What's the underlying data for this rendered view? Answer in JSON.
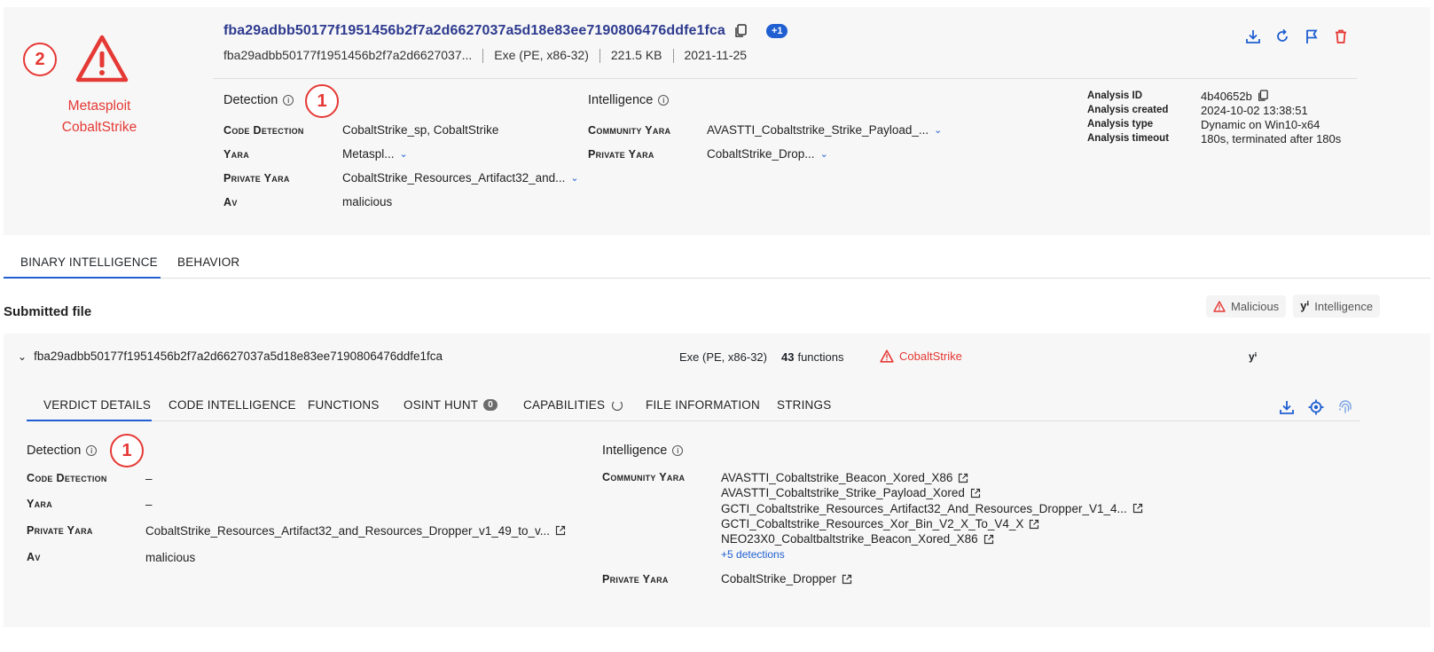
{
  "header": {
    "marker_2": "2",
    "verdict_lines": [
      "Metasploit",
      "CobaltStrike"
    ],
    "hash": "fba29adbb50177f1951456b2f7a2d6627037a5d18e83ee7190806476ddfe1fca",
    "plus_badge": "+1",
    "meta": {
      "short_hash": "fba29adbb50177f1951456b2f7a2d6627037...",
      "type": "Exe (PE, x86-32)",
      "size": "221.5 KB",
      "date": "2021-11-25"
    },
    "detection": {
      "title": "Detection",
      "marker": "1",
      "rows": [
        {
          "label": "Code Detection",
          "value": "CobaltStrike_sp, CobaltStrike",
          "dropdown": false
        },
        {
          "label": "Yara",
          "value": "Metaspl...",
          "dropdown": true
        },
        {
          "label": "Private Yara",
          "value": "CobaltStrike_Resources_Artifact32_and...",
          "dropdown": true
        },
        {
          "label": "Av",
          "value": "malicious",
          "dropdown": false
        }
      ]
    },
    "intelligence": {
      "title": "Intelligence",
      "rows": [
        {
          "label": "Community Yara",
          "value": "AVASTTI_Cobaltstrike_Strike_Payload_..."
        },
        {
          "label": "Private Yara",
          "value": "CobaltStrike_Drop..."
        }
      ]
    },
    "analysis": [
      {
        "label": "Analysis ID",
        "value": "4b40652b"
      },
      {
        "label": "Analysis created",
        "value": "2024-10-02 13:38:51"
      },
      {
        "label": "Analysis type",
        "value": "Dynamic on Win10-x64"
      },
      {
        "label": "Analysis timeout",
        "value": "180s, terminated after 180s"
      }
    ]
  },
  "main_tabs": [
    "BINARY INTELLIGENCE",
    "BEHAVIOR"
  ],
  "submitted": {
    "title": "Submitted file",
    "chips": {
      "malicious": "Malicious",
      "intelligence_icon": "yⁱ",
      "intelligence": "Intelligence"
    },
    "file": {
      "hash": "fba29adbb50177f1951456b2f7a2d6627037a5d18e83ee7190806476ddfe1fca",
      "type": "Exe (PE, x86-32)",
      "functions_count": "43",
      "functions_label": "functions",
      "verdict": "CobaltStrike",
      "intel_icon": "yⁱ"
    },
    "tabs": {
      "verdict": "VERDICT DETAILS",
      "code": "CODE INTELLIGENCE",
      "functions": "FUNCTIONS",
      "osint": "OSINT HUNT",
      "osint_count": "0",
      "capabilities": "CAPABILITIES",
      "fileinfo": "FILE INFORMATION",
      "strings": "STRINGS"
    },
    "detection": {
      "title": "Detection",
      "marker": "1",
      "rows": [
        {
          "label": "Code Detection",
          "value": "–"
        },
        {
          "label": "Yara",
          "value": "–"
        },
        {
          "label": "Private Yara",
          "value": "CobaltStrike_Resources_Artifact32_and_Resources_Dropper_v1_49_to_v..."
        },
        {
          "label": "Av",
          "value": "malicious"
        }
      ]
    },
    "intelligence": {
      "title": "Intelligence",
      "community_label": "Community Yara",
      "community": [
        "AVASTTI_Cobaltstrike_Beacon_Xored_X86",
        "AVASTTI_Cobaltstrike_Strike_Payload_Xored",
        "GCTI_Cobaltstrike_Resources_Artifact32_And_Resources_Dropper_V1_4...",
        "GCTI_Cobaltstrike_Resources_Xor_Bin_V2_X_To_V4_X",
        "NEO23X0_Cobaltbaltstrike_Beacon_Xored_X86"
      ],
      "more": "+5 detections",
      "private_label": "Private Yara",
      "private": "CobaltStrike_Dropper"
    }
  },
  "colors": {
    "accent": "#1f5fd1",
    "danger": "#e53935",
    "title": "#2e3b8f"
  }
}
